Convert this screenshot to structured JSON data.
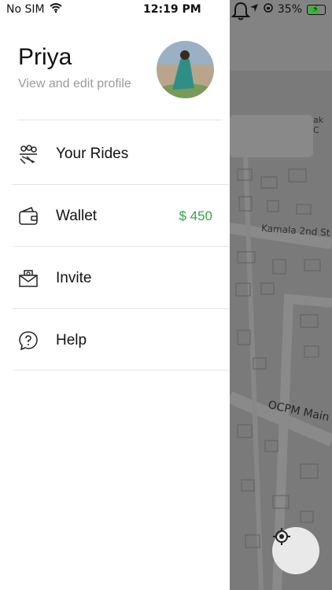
{
  "status_bar": {
    "carrier": "No SIM",
    "time": "12:19 PM",
    "battery": "35%"
  },
  "profile": {
    "name": "Priya",
    "subtitle": "View and edit profile"
  },
  "menu": [
    {
      "label": "Your Rides",
      "icon": "rides-icon"
    },
    {
      "label": "Wallet",
      "icon": "wallet-icon",
      "amount": "$ 450"
    },
    {
      "label": "Invite",
      "icon": "invite-icon"
    },
    {
      "label": "Help",
      "icon": "help-icon"
    }
  ],
  "map": {
    "street_1": "Kamala 2nd St",
    "street_2": "OCPM Main",
    "edge_text": "ak C"
  },
  "colors": {
    "accent_green": "#2ea84a",
    "battery_green": "#39b53a",
    "map_bg": "#c8c8c8"
  }
}
